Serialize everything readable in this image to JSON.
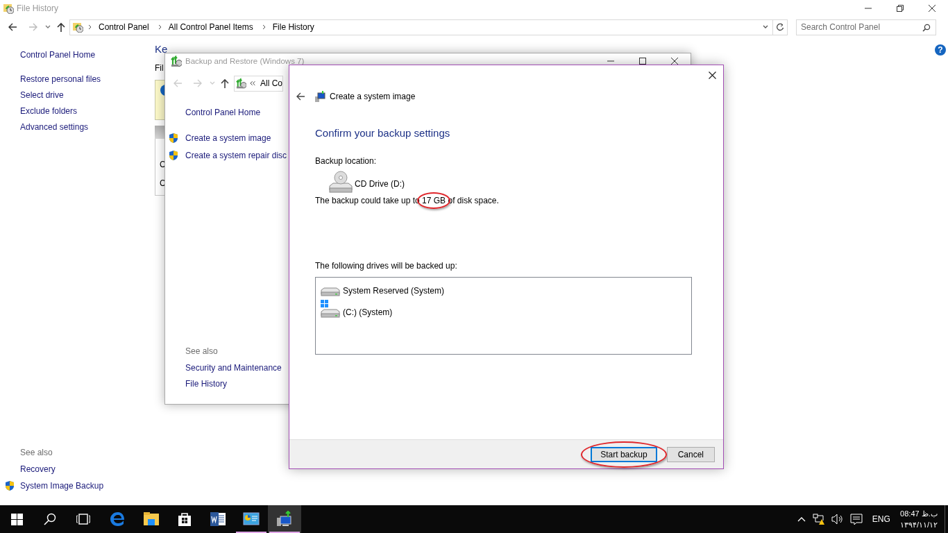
{
  "window": {
    "title": "File History"
  },
  "address_bar": {
    "crumbs": [
      "Control Panel",
      "All Control Panel Items",
      "File History"
    ]
  },
  "search": {
    "placeholder": "Search Control Panel"
  },
  "help": "?",
  "sidebar": {
    "items": [
      "Control Panel Home",
      "Restore personal files",
      "Select drive",
      "Exclude folders",
      "Advanced settings"
    ],
    "see_also_title": "See also",
    "see_also": [
      {
        "label": "Recovery",
        "shield": false
      },
      {
        "label": "System Image Backup",
        "shield": true
      }
    ]
  },
  "content": {
    "heading": "Ke",
    "subtitle": "Fil",
    "rows": [
      "C",
      "C"
    ]
  },
  "backup_window": {
    "title": "Backup and Restore (Windows 7)",
    "address": "All Co",
    "home": "Control Panel Home",
    "tasks": [
      {
        "label": "Create a system image",
        "shield": true
      },
      {
        "label": "Create a system repair disc",
        "shield": true
      }
    ],
    "see_also_title": "See also",
    "see_also": [
      "Security and Maintenance",
      "File History"
    ]
  },
  "dialog": {
    "nav_title": "Create a system image",
    "heading": "Confirm your backup settings",
    "location_label": "Backup location:",
    "location": "CD Drive (D:)",
    "size_before": "The backup could take up to",
    "size": "17 GB",
    "size_after": "of disk space.",
    "size_highlighted": true,
    "drives_label": "The following drives will be backed up:",
    "drives": [
      {
        "name": "System Reserved (System)",
        "windows_logo": false
      },
      {
        "name": "(C:) (System)",
        "windows_logo": true
      }
    ],
    "buttons": [
      {
        "label": "Start backup",
        "default": true,
        "highlighted": true
      },
      {
        "label": "Cancel",
        "default": false,
        "highlighted": false
      }
    ]
  },
  "taskbar": {
    "apps": [
      {
        "kind": "edge",
        "running": false,
        "active": false
      },
      {
        "kind": "explorer",
        "running": false,
        "active": false
      },
      {
        "kind": "store",
        "running": false,
        "active": false
      },
      {
        "kind": "word",
        "running": false,
        "active": false
      },
      {
        "kind": "control-panel",
        "running": true,
        "active": false
      },
      {
        "kind": "backup",
        "running": true,
        "active": true
      }
    ],
    "language": "ENG",
    "time": "08:47 ب.ظ",
    "date": "۱۳۹۴/۱۱/۱۲"
  }
}
